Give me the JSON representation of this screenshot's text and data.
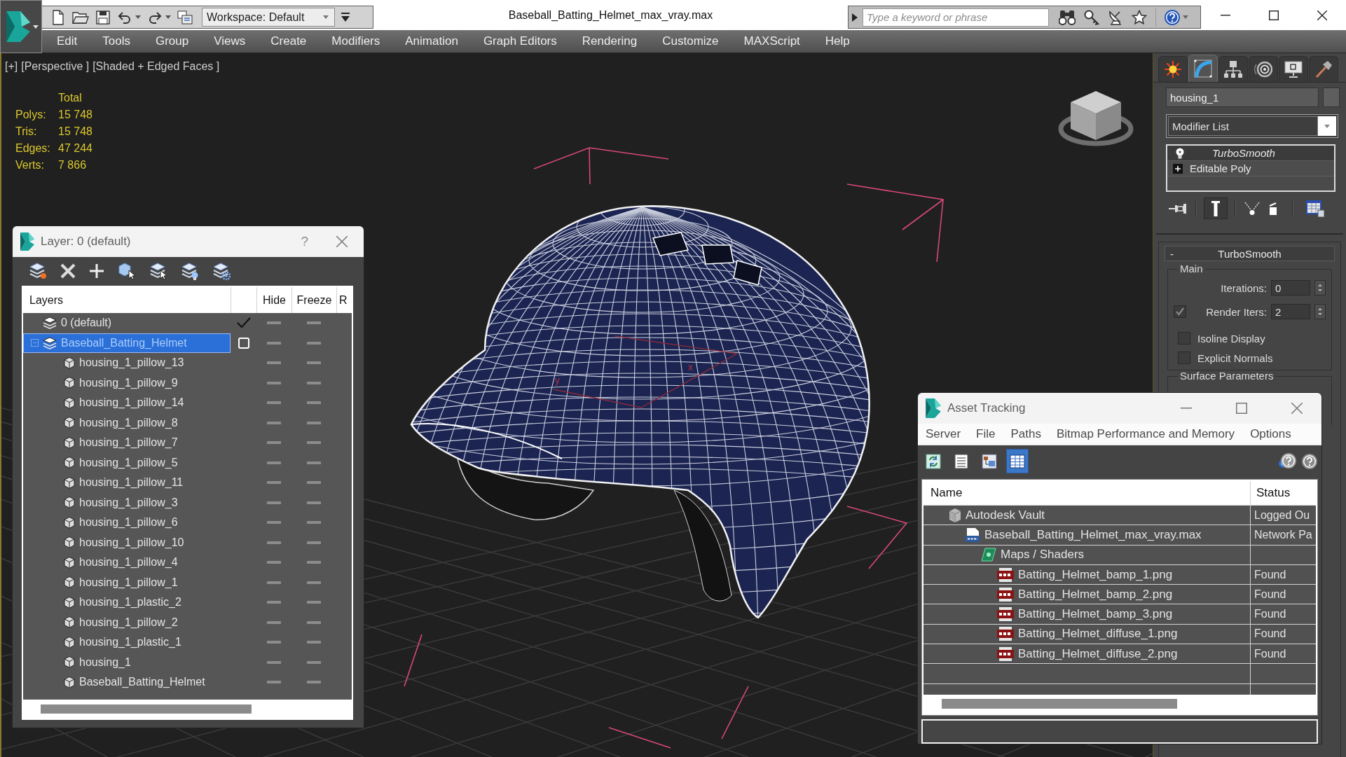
{
  "title_bar": {
    "workspace": "Workspace: Default",
    "title": "Baseball_Batting_Helmet_max_vray.max",
    "search": {
      "placeholder": "Type a keyword or phrase"
    }
  },
  "menu_bar": [
    "Edit",
    "Tools",
    "Group",
    "Views",
    "Create",
    "Modifiers",
    "Animation",
    "Graph Editors",
    "Rendering",
    "Customize",
    "MAXScript",
    "Help"
  ],
  "viewport": {
    "labels": [
      "[+]",
      "[Perspective ]",
      "[Shaded + Edged Faces ]"
    ],
    "stats": {
      "header": "Total",
      "rows": [
        {
          "label": "Polys:",
          "value": "15 748"
        },
        {
          "label": "Tris:",
          "value": "15 748"
        },
        {
          "label": "Edges:",
          "value": "47 244"
        },
        {
          "label": "Verts:",
          "value": "7 866"
        }
      ]
    },
    "gizmo_labels": [
      "y",
      "x"
    ]
  },
  "command_panel": {
    "tabs": [
      {
        "selected": false
      },
      {
        "selected": true
      },
      {
        "selected": false
      },
      {
        "selected": false
      },
      {
        "selected": false
      },
      {
        "selected": false
      }
    ],
    "object_name": "housing_1",
    "modifier_list": "Modifier List",
    "stack": [
      {
        "kind": "modifier",
        "label": "TurboSmooth"
      },
      {
        "kind": "base",
        "label": "Editable Poly"
      }
    ],
    "rollout": {
      "title": "TurboSmooth",
      "toggle": "-",
      "group": "Main",
      "iterations": {
        "label": "Iterations:",
        "value": "0"
      },
      "render_iters": {
        "label": "Render Iters:",
        "value": "2",
        "checked": true
      },
      "checkboxes": [
        {
          "label": "Isoline Display",
          "checked": false
        },
        {
          "label": "Explicit Normals",
          "checked": false
        }
      ],
      "next_group": "Surface Parameters"
    }
  },
  "layer_dialog": {
    "title": "Layer: 0 (default)",
    "help": "?",
    "columns": [
      "Layers",
      "Hide",
      "Freeze",
      "R"
    ],
    "layers": [
      {
        "name": "0 (default)",
        "current": true,
        "selected": false,
        "hidden": false,
        "frozen": false
      },
      {
        "name": "Baseball_Batting_Helmet",
        "current": false,
        "selected": true,
        "expanded": true,
        "hidden": false,
        "frozen": false,
        "children": [
          {
            "name": "housing_1_pillow_13",
            "selected": false,
            "hidden": false,
            "frozen": false
          },
          {
            "name": "housing_1_pillow_9",
            "selected": false,
            "hidden": false,
            "frozen": false
          },
          {
            "name": "housing_1_pillow_14",
            "selected": false,
            "hidden": false,
            "frozen": false
          },
          {
            "name": "housing_1_pillow_8",
            "selected": false,
            "hidden": false,
            "frozen": false
          },
          {
            "name": "housing_1_pillow_7",
            "selected": false,
            "hidden": false,
            "frozen": false
          },
          {
            "name": "housing_1_pillow_5",
            "selected": false,
            "hidden": false,
            "frozen": false
          },
          {
            "name": "housing_1_pillow_11",
            "selected": false,
            "hidden": false,
            "frozen": false
          },
          {
            "name": "housing_1_pillow_3",
            "selected": false,
            "hidden": false,
            "frozen": false
          },
          {
            "name": "housing_1_pillow_6",
            "selected": false,
            "hidden": false,
            "frozen": false
          },
          {
            "name": "housing_1_pillow_10",
            "selected": false,
            "hidden": false,
            "frozen": false
          },
          {
            "name": "housing_1_pillow_4",
            "selected": false,
            "hidden": false,
            "frozen": false
          },
          {
            "name": "housing_1_pillow_1",
            "selected": false,
            "hidden": false,
            "frozen": false
          },
          {
            "name": "housing_1_plastic_2",
            "selected": false,
            "hidden": false,
            "frozen": false
          },
          {
            "name": "housing_1_pillow_2",
            "selected": false,
            "hidden": false,
            "frozen": false
          },
          {
            "name": "housing_1_plastic_1",
            "selected": false,
            "hidden": false,
            "frozen": false
          },
          {
            "name": "housing_1",
            "selected": false,
            "hidden": false,
            "frozen": false
          },
          {
            "name": "Baseball_Batting_Helmet",
            "selected": false,
            "hidden": false,
            "frozen": false
          }
        ]
      }
    ]
  },
  "asset_tracking": {
    "title": "Asset Tracking",
    "menu": [
      "Server",
      "File",
      "Paths",
      "Bitmap Performance and Memory",
      "Options"
    ],
    "toolbar": [
      {
        "selected": false
      },
      {
        "selected": false
      },
      {
        "selected": false
      },
      {
        "selected": true
      }
    ],
    "columns": [
      "Name",
      "Status"
    ],
    "rows": [
      {
        "kind": "vault",
        "name": "Autodesk Vault",
        "status": "Logged Ou",
        "children": [
          {
            "kind": "max",
            "name": "Baseball_Batting_Helmet_max_vray.max",
            "status": "Network Pa",
            "children": [
              {
                "kind": "folder",
                "name": "Maps / Shaders",
                "children": [
                  {
                    "kind": "png",
                    "name": "Batting_Helmet_bamp_1.png",
                    "status": "Found"
                  },
                  {
                    "kind": "png",
                    "name": "Batting_Helmet_bamp_2.png",
                    "status": "Found"
                  },
                  {
                    "kind": "png",
                    "name": "Batting_Helmet_bamp_3.png",
                    "status": "Found"
                  },
                  {
                    "kind": "png",
                    "name": "Batting_Helmet_diffuse_1.png",
                    "status": "Found"
                  },
                  {
                    "kind": "png",
                    "name": "Batting_Helmet_diffuse_2.png",
                    "status": "Found"
                  }
                ]
              }
            ]
          }
        ]
      }
    ]
  }
}
